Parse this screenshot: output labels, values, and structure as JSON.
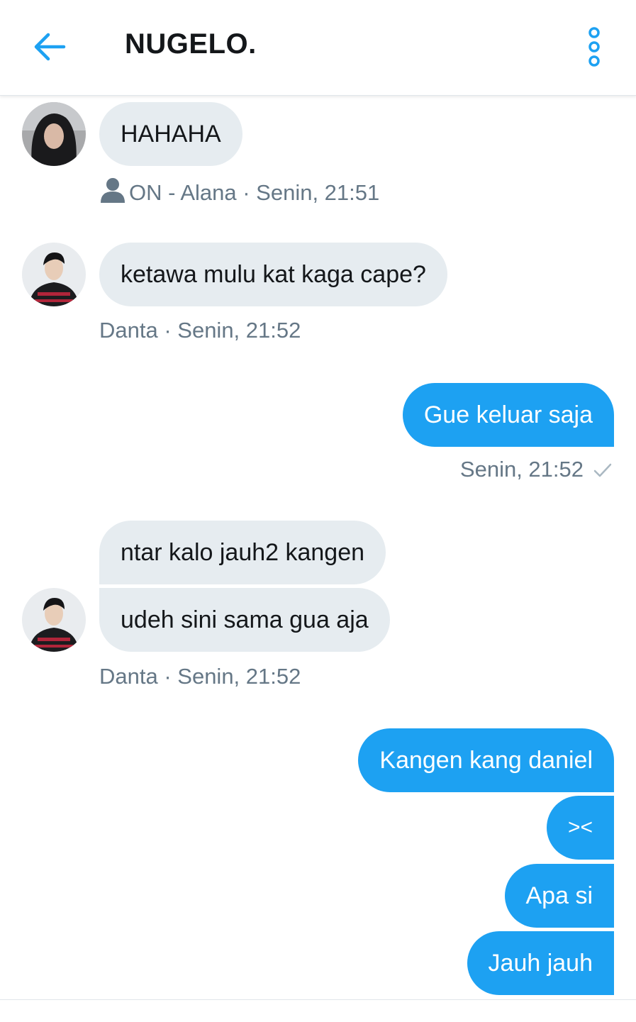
{
  "header": {
    "title": "NUGELO.",
    "back_icon": "arrow-left-icon",
    "more_icon": "more-vertical-icon",
    "accent": "#1da1f2"
  },
  "messages": [
    {
      "side": "in",
      "text": "HAHAHA"
    },
    {
      "side": "in",
      "text": "ketawa mulu kat kaga cape?"
    },
    {
      "side": "out",
      "text": "Gue keluar saja"
    },
    {
      "side": "in",
      "text": "ntar kalo jauh2 kangen"
    },
    {
      "side": "in",
      "text": "udeh sini sama gua aja"
    },
    {
      "side": "out",
      "text": "Kangen kang daniel"
    },
    {
      "side": "out",
      "text": "><"
    },
    {
      "side": "out",
      "text": "Apa si"
    },
    {
      "side": "out",
      "text": "Jauh jauh"
    }
  ],
  "meta": {
    "m1": "ON - Alana · Senin, 21:51",
    "m2": "Danta · Senin, 21:52",
    "m3": "Senin, 21:52",
    "m4": "Danta · Senin, 21:52"
  },
  "colors": {
    "incoming_bubble": "#e6ecf0",
    "outgoing_bubble": "#1da1f2",
    "meta_text": "#657786"
  }
}
